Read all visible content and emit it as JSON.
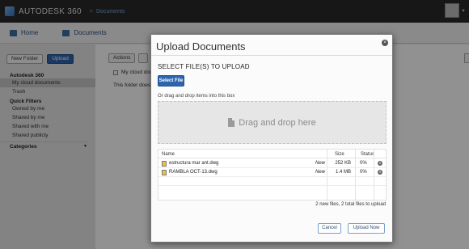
{
  "app": {
    "brand": "AUTODESK 360",
    "breadcrumb_sep": ">",
    "breadcrumb": "Documents"
  },
  "nav": {
    "home": "Home",
    "documents": "Documents"
  },
  "sidebar": {
    "new_folder": "New Folder",
    "upload": "Upload",
    "section_title": "Autodesk 360",
    "items": [
      "My cloud documents",
      "Trash"
    ],
    "quick_filters_title": "Quick Filters",
    "filters": [
      "Owned by me",
      "Shared by me",
      "Shared with me",
      "Shared publicly"
    ],
    "categories": "Categories"
  },
  "main": {
    "actions": "Actions",
    "folder_label": "My cloud docu",
    "empty_message": "This folder doesn"
  },
  "modal": {
    "title": "Upload Documents",
    "close": "×",
    "select_heading": "SELECT FILE(S) TO UPLOAD",
    "select_button": "Select File",
    "or_drag": "Or drag and drop items into this box",
    "dropzone_text": "Drag and drop here",
    "columns": {
      "name": "Name",
      "size": "Size",
      "status": "Status"
    },
    "files": [
      {
        "name": "estructura mar ant.dwg",
        "flag": "New",
        "size": "252 KB",
        "status": "0%"
      },
      {
        "name": "RAMBLA OCT-13.dwg",
        "flag": "New",
        "size": "1.4 MB",
        "status": "0%"
      }
    ],
    "summary": "2 new files, 2 total files to upload",
    "cancel": "Cancel",
    "upload_now": "Upload Now"
  },
  "colors": {
    "accent": "#2e64ad",
    "topbar": "#2a2a2a",
    "overlay": "rgba(0,0,0,0.43)"
  }
}
